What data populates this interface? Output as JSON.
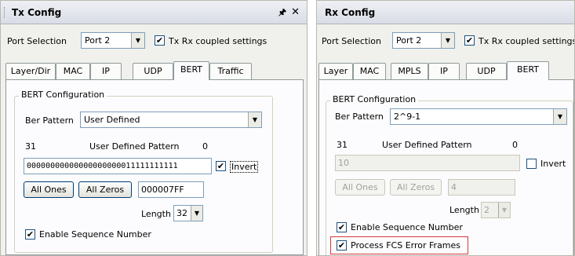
{
  "tx": {
    "title": "Tx Config",
    "pin_icon": "pin-icon",
    "close_icon": "close-icon",
    "port_label": "Port Selection",
    "port_value": "Port 2",
    "coupled_label": "Tx Rx coupled settings",
    "coupled_checked": true,
    "tabs": [
      "Layer/Dir",
      "MAC",
      "IP",
      "UDP",
      "BERT",
      "Traffic"
    ],
    "active_tab": "BERT",
    "group_title": "BERT Configuration",
    "pattern_label": "Ber Pattern",
    "pattern_value": "User Defined",
    "bit_high": "31",
    "udp_label": "User Defined Pattern",
    "bit_low": "0",
    "pattern_bits": "00000000000000000000011111111111",
    "invert_label": "Invert",
    "invert_checked": true,
    "all_ones": "All Ones",
    "all_zeros": "All Zeros",
    "hex_value": "000007FF",
    "length_label": "Length",
    "length_value": "32",
    "seq_label": "Enable Sequence Number",
    "seq_checked": true
  },
  "rx": {
    "title": "Rx Config",
    "port_label": "Port Selection",
    "port_value": "Port 2",
    "coupled_label": "Tx Rx coupled settings",
    "coupled_checked": true,
    "tabs": [
      "Layer",
      "MAC",
      "MPLS",
      "IP",
      "UDP",
      "BERT"
    ],
    "active_tab": "BERT",
    "group_title": "BERT Configuration",
    "pattern_label": "Ber Pattern",
    "pattern_value": "2^9-1",
    "bit_high": "31",
    "udp_label": "User Defined Pattern",
    "bit_low": "0",
    "pattern_value_field": "10",
    "invert_label": "Invert",
    "invert_checked": false,
    "all_ones": "All Ones",
    "all_zeros": "All Zeros",
    "hex_value": "4",
    "length_label": "Length",
    "length_value": "2",
    "seq_label": "Enable Sequence Number",
    "seq_checked": true,
    "fcs_label": "Process FCS Error Frames",
    "fcs_checked": true,
    "highlight_color": "#d73a3a"
  }
}
